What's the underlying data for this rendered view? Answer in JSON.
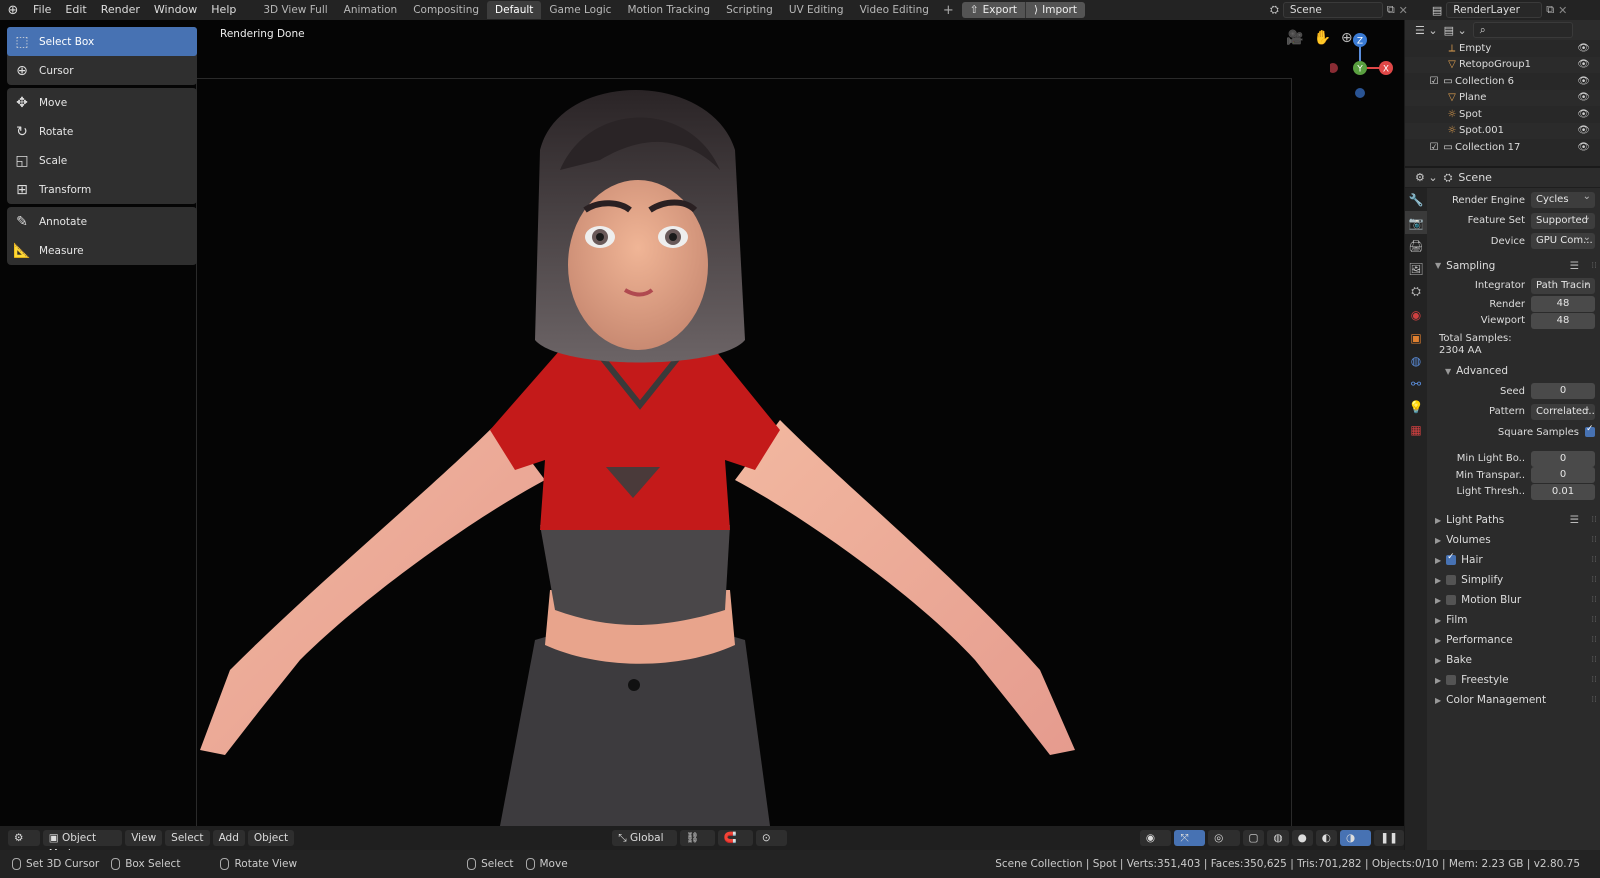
{
  "topbar": {
    "menu": [
      "File",
      "Edit",
      "Render",
      "Window",
      "Help"
    ],
    "tabs": [
      "3D View Full",
      "Animation",
      "Compositing",
      "Default",
      "Game Logic",
      "Motion Tracking",
      "Scripting",
      "UV Editing",
      "Video Editing"
    ],
    "active_tab": "Default",
    "export_label": "Export",
    "import_label": "Import",
    "scene_name": "Scene",
    "render_layer": "RenderLayer"
  },
  "viewport": {
    "status_text": "Rendering Done",
    "tools_group1": [
      "Select Box",
      "Cursor"
    ],
    "tools_group2": [
      "Move",
      "Rotate",
      "Scale",
      "Transform"
    ],
    "tools_group3": [
      "Annotate",
      "Measure"
    ],
    "gizmo": {
      "z": "Z",
      "y": "Y",
      "x": "X"
    }
  },
  "viewport_header": {
    "mode": "Object Mode",
    "menus": [
      "View",
      "Select",
      "Add",
      "Object"
    ],
    "orientation": "Global"
  },
  "statusbar": {
    "items": [
      "Set 3D Cursor",
      "Box Select",
      "Rotate View",
      "Select",
      "Move"
    ],
    "stats": "Scene Collection | Spot | Verts:351,403 | Faces:350,625 | Tris:701,282 | Objects:0/10 | Mem: 2.23 GB | v2.80.75"
  },
  "outliner": {
    "rows": [
      {
        "name": "Empty",
        "icon": "empty-icon",
        "indent": 1
      },
      {
        "name": "RetopoGroup1",
        "icon": "mesh-icon",
        "indent": 1
      },
      {
        "name": "Collection 6",
        "icon": "collection-icon",
        "indent": 0
      },
      {
        "name": "Plane",
        "icon": "mesh-icon",
        "indent": 1
      },
      {
        "name": "Spot",
        "icon": "light-icon",
        "indent": 1
      },
      {
        "name": "Spot.001",
        "icon": "light-icon",
        "indent": 1
      },
      {
        "name": "Collection 17",
        "icon": "collection-icon",
        "indent": 0
      }
    ]
  },
  "properties": {
    "header": "Scene",
    "render_engine_label": "Render Engine",
    "render_engine": "Cycles",
    "feature_set_label": "Feature Set",
    "feature_set": "Supported",
    "device_label": "Device",
    "device": "GPU Com...",
    "sampling_label": "Sampling",
    "integrator_label": "Integrator",
    "integrator": "Path Tracin",
    "render_label": "Render",
    "render_samples": "48",
    "viewport_label": "Viewport",
    "viewport_samples": "48",
    "total_samples_label": "Total Samples:",
    "total_samples_value": "2304 AA",
    "advanced_label": "Advanced",
    "seed_label": "Seed",
    "seed": "0",
    "pattern_label": "Pattern",
    "pattern": "Correlated...",
    "square_samples_label": "Square Samples",
    "min_light_label": "Min Light Bo..",
    "min_light": "0",
    "min_transp_label": "Min Transpar..",
    "min_transp": "0",
    "light_thresh_label": "Light Thresh..",
    "light_thresh": "0.01",
    "sections": [
      "Light Paths",
      "Volumes",
      "Hair",
      "Simplify",
      "Motion Blur",
      "Film",
      "Performance",
      "Bake",
      "Freestyle",
      "Color Management"
    ]
  }
}
